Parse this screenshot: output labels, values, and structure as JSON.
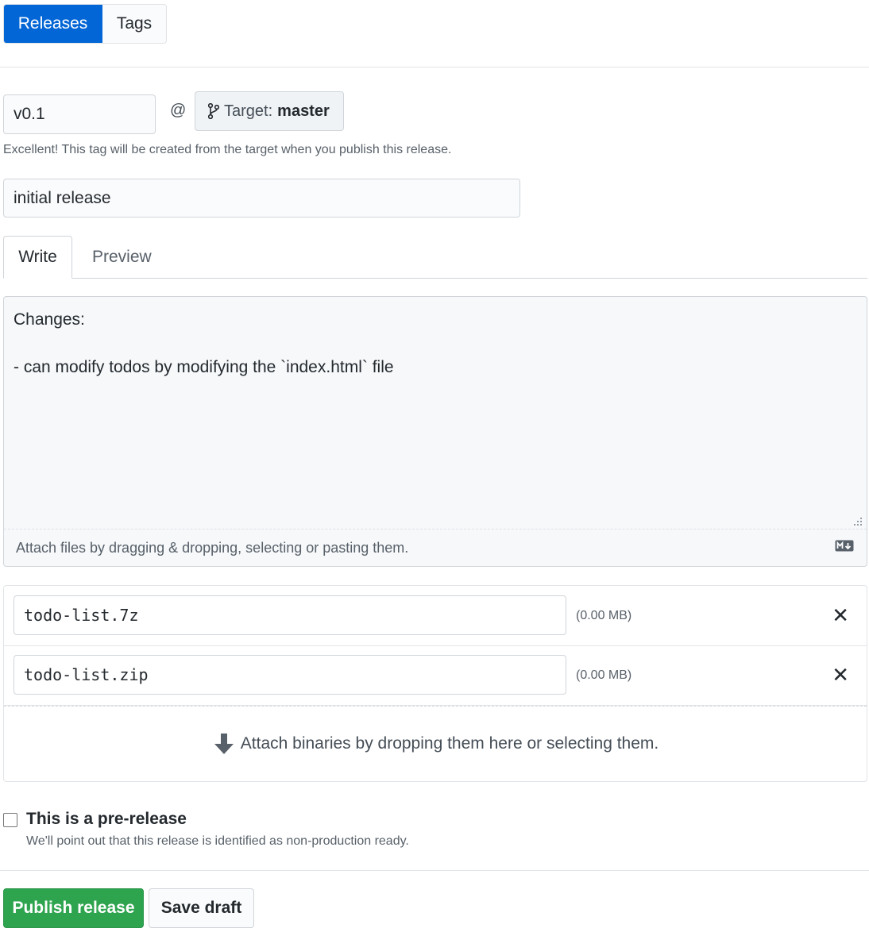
{
  "header_tabs": {
    "releases": "Releases",
    "tags": "Tags"
  },
  "tag": {
    "value": "v0.1",
    "at_symbol": "@",
    "target_label": "Target:",
    "target_branch": "master",
    "note": "Excellent! This tag will be created from the target when you publish this release."
  },
  "release_title": {
    "value": "initial release"
  },
  "editor": {
    "tab_write": "Write",
    "tab_preview": "Preview",
    "body": "Changes:\n\n- can modify todos by modifying the `index.html` file",
    "attach_hint": "Attach files by dragging & dropping, selecting or pasting them."
  },
  "binaries": {
    "files": [
      {
        "name": "todo-list.7z",
        "size": "(0.00 MB)"
      },
      {
        "name": "todo-list.zip",
        "size": "(0.00 MB)"
      }
    ],
    "remove_glyph": "✕",
    "drop_hint": "Attach binaries by dropping them here or selecting them."
  },
  "prerelease": {
    "label": "This is a pre-release",
    "note": "We'll point out that this release is identified as non-production ready.",
    "checked": false
  },
  "actions": {
    "publish": "Publish release",
    "save_draft": "Save draft"
  },
  "colors": {
    "primary": "#0366d6",
    "success": "#2ea44f"
  },
  "icons": [
    "git-branch-icon",
    "markdown-icon",
    "resize-grip-icon",
    "close-icon",
    "arrow-down-icon"
  ]
}
